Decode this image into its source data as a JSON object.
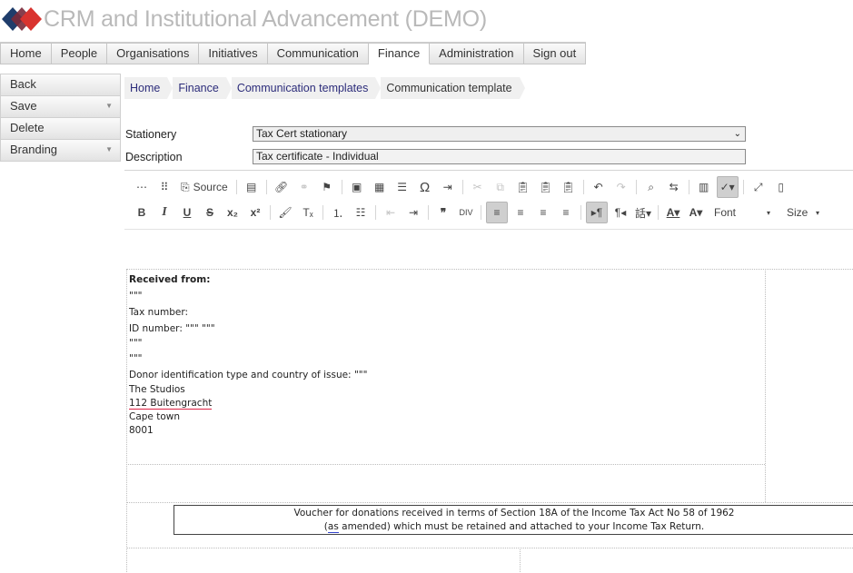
{
  "app": {
    "title": "CRM and Institutional Advancement (DEMO)"
  },
  "topnav": [
    "Home",
    "People",
    "Organisations",
    "Initiatives",
    "Communication",
    "Finance",
    "Administration",
    "Sign out"
  ],
  "topnav_active": "Finance",
  "sidemenu": [
    {
      "label": "Back",
      "dropdown": false
    },
    {
      "label": "Save",
      "dropdown": true
    },
    {
      "label": "Delete",
      "dropdown": false
    },
    {
      "label": "Branding",
      "dropdown": true
    }
  ],
  "breadcrumb": [
    "Home",
    "Finance",
    "Communication templates",
    "Communication template"
  ],
  "form": {
    "stationery_label": "Stationery",
    "stationery_value": "Tax Cert stationary",
    "description_label": "Description",
    "description_value": "Tax certificate - Individual"
  },
  "toolbar": {
    "row1": [
      "dots-icon",
      "blocks-icon",
      "source-icon",
      "document-icon",
      "link-icon",
      "unlink-icon",
      "anchor-flag-icon",
      "image-icon",
      "table-icon",
      "horizontal-line-icon",
      "omega-icon",
      "page-break-icon",
      "cut-icon",
      "copy-icon",
      "paste-icon",
      "paste-text-icon",
      "paste-word-icon",
      "undo-icon",
      "redo-icon",
      "find-icon",
      "replace-icon",
      "select-all-icon",
      "spellcheck-icon",
      "maximize-icon",
      "show-blocks-icon"
    ],
    "source_label": "Source",
    "font_label": "Font",
    "size_label": "Size"
  },
  "document": {
    "received_from": "Received from:",
    "placeholder1": "\"\"\"",
    "tax_number": "Tax number:",
    "id_number": "ID number:",
    "id_placeholder": "\"\"\" \"\"\"",
    "placeholder2": "\"\"\"",
    "placeholder3": "\"\"\"",
    "donor_line": "Donor identification type and country of issue:",
    "donor_placeholder": "\"\"\"",
    "address": [
      "The Studios",
      "112 Buitengracht",
      "Cape town",
      "8001"
    ],
    "voucher_line1": "Voucher for donations received in terms of Section 18A of the Income Tax Act No 58 of 1962",
    "voucher_line2_as": "as",
    "voucher_line2_open": "(",
    "voucher_line2_rest": " amended) which must be retained and attached to your Income Tax Return."
  },
  "colors": {
    "title_gray": "#b9b9b9",
    "logo_red": "#c0392b",
    "logo_blue": "#2c4a7a",
    "link": "#2c2c7a"
  }
}
